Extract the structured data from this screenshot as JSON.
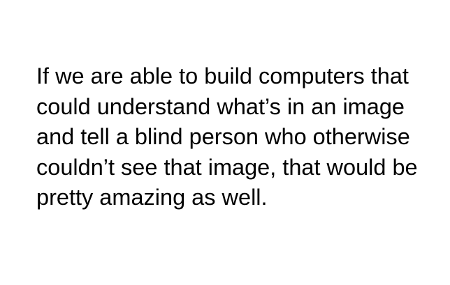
{
  "quote": {
    "lines": [
      "If we are able to build computers that",
      "could understand what’s in an image",
      "and tell a blind person who otherwise",
      "couldn’t see that image, that would be",
      "pretty amazing as well."
    ]
  }
}
